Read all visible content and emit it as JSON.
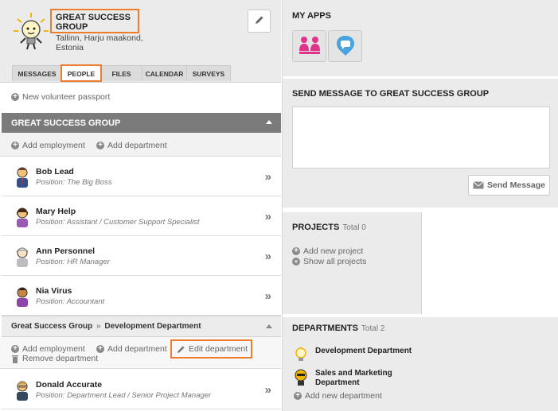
{
  "org": {
    "name": "GREAT SUCCESS GROUP",
    "location": "Tallinn, Harju maakond, Estonia"
  },
  "tabs": [
    {
      "label": "MESSAGES",
      "active": false
    },
    {
      "label": "PEOPLE",
      "active": true
    },
    {
      "label": "FILES",
      "active": false
    },
    {
      "label": "CALENDAR",
      "active": false
    },
    {
      "label": "SURVEYS",
      "active": false
    }
  ],
  "passport_link": "New volunteer passport",
  "group": {
    "title": "GREAT SUCCESS GROUP",
    "add_employment": "Add employment",
    "add_department": "Add department",
    "members": [
      {
        "name": "Bob Lead",
        "position": "Position: The Big Boss"
      },
      {
        "name": "Mary Help",
        "position": "Position: Assistant / Customer Support Specialist"
      },
      {
        "name": "Ann Personnel",
        "position": "Position: HR Manager"
      },
      {
        "name": "Nia Virus",
        "position": "Position: Accountant"
      }
    ]
  },
  "department": {
    "breadcrumb_parent": "Great Success Group",
    "breadcrumb_sep": "»",
    "breadcrumb_child": "Development Department",
    "add_employment": "Add employment",
    "add_department": "Add department",
    "edit_department": "Edit department",
    "remove_department": "Remove department",
    "members": [
      {
        "name": "Donald Accurate",
        "position": "Position: Department Lead / Senior Project Manager"
      }
    ]
  },
  "apps": {
    "title": "MY APPS",
    "items": [
      {
        "icon": "people-group-icon",
        "color": "#e0338a"
      },
      {
        "icon": "chat-bubble-icon",
        "color": "#4aa3df"
      }
    ]
  },
  "send_message": {
    "title": "SEND MESSAGE TO GREAT SUCCESS GROUP",
    "message_value": "",
    "button_label": "Send Message"
  },
  "projects": {
    "title": "PROJECTS",
    "total": "Total 0",
    "add_new": "Add new project",
    "show_all": "Show all projects"
  },
  "departments": {
    "title": "DEPARTMENTS",
    "total": "Total 2",
    "items": [
      {
        "name": "Development Department"
      },
      {
        "name": "Sales and Marketing Department"
      }
    ],
    "add_new": "Add new department"
  },
  "colors": {
    "highlight": "#ee7c2c",
    "group_bar": "#7b7b7b",
    "panel_bg": "#ebebeb"
  }
}
